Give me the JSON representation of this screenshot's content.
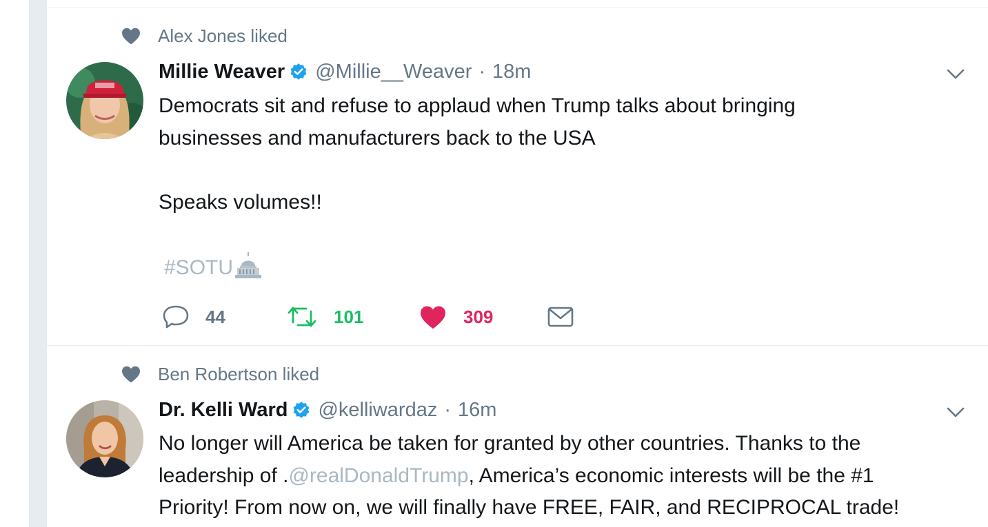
{
  "tweets": [
    {
      "context_text": "Alex Jones liked",
      "fullname": "Millie Weaver",
      "handle": "@Millie__Weaver",
      "separator": "·",
      "time": "18m",
      "line1": "Democrats sit and refuse to applaud when Trump talks about bringing",
      "line2": "businesses and manufacturers back to the USA",
      "line3": "Speaks volumes!!",
      "hashtag": "#SOTU",
      "reply_count": "44",
      "retweet_count": "101",
      "like_count": "309"
    },
    {
      "context_text": "Ben Robertson liked",
      "fullname": "Dr. Kelli Ward",
      "handle": "@kelliwardaz",
      "separator": "·",
      "time": "16m",
      "line1": "No longer will America be taken for granted by other countries. Thanks to the",
      "line2_pre": "leadership of .",
      "line2_mention": "@realDonaldTrump",
      "line2_post": ", America’s economic interests will be the #1",
      "line3": "Priority! From now on, we will finally have FREE, FAIR, and RECIPROCAL trade!"
    }
  ],
  "colors": {
    "primary_text": "#14171a",
    "secondary_text": "#657786",
    "verified_blue": "#1da1f2",
    "retweet_green": "#17bf63",
    "like_red": "#e0245e",
    "muted_link": "#aab8c2",
    "divider": "#e6ecf0"
  },
  "icons": [
    "heart-icon",
    "verified-badge-icon",
    "chevron-down-icon",
    "reply-icon",
    "retweet-icon",
    "like-icon",
    "direct-message-icon",
    "capitol-emoji"
  ]
}
